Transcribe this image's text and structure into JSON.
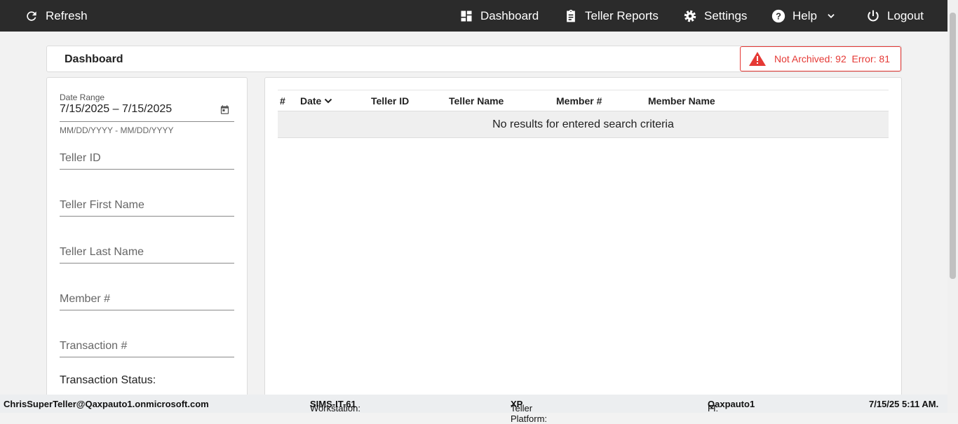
{
  "topbar": {
    "refresh": "Refresh",
    "dashboard": "Dashboard",
    "teller_reports": "Teller Reports",
    "settings": "Settings",
    "help": "Help",
    "logout": "Logout"
  },
  "header": {
    "title": "Dashboard",
    "alert_not_archived": "Not Archived: 92",
    "alert_error": "Error: 81"
  },
  "filters": {
    "date_range_label": "Date Range",
    "date_range_value": "7/15/2025 – 7/15/2025",
    "date_hint": "MM/DD/YYYY - MM/DD/YYYY",
    "teller_id": "Teller ID",
    "teller_first_name": "Teller First Name",
    "teller_last_name": "Teller Last Name",
    "member_number": "Member #",
    "transaction_number": "Transaction #",
    "transaction_status": "Transaction Status:"
  },
  "table": {
    "columns": [
      "#",
      "Date",
      "Teller ID",
      "Teller Name",
      "Member #",
      "Member Name"
    ],
    "empty": "No results for entered search criteria"
  },
  "status": {
    "user": "ChrisSuperTeller@Qaxpauto1.onmicrosoft.com",
    "workstation_label": "Workstation:",
    "workstation": "SIMS-IT-61",
    "platform_label": "Teller Platform:",
    "platform": "XP",
    "fi_label": "FI:",
    "fi": "Qaxpauto1",
    "datetime": "7/15/25 5:11 AM."
  }
}
